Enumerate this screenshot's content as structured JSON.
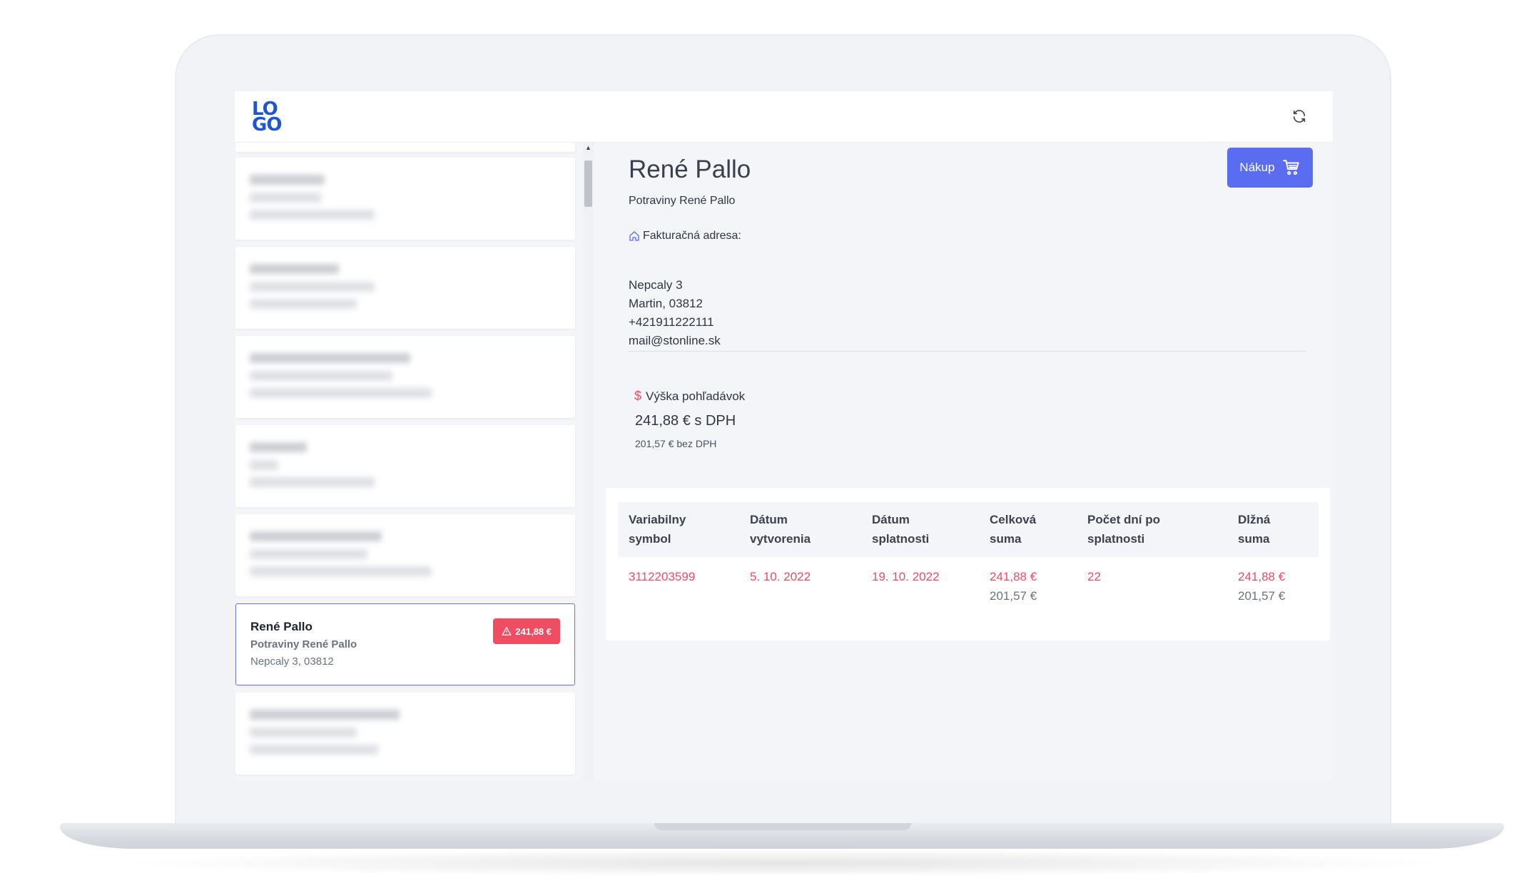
{
  "topbar": {
    "logo_top": "LO",
    "logo_bottom": "GO"
  },
  "customer_list": [
    {
      "blurred": true
    },
    {
      "blurred": true
    },
    {
      "blurred": true
    },
    {
      "blurred": true
    },
    {
      "blurred": true
    },
    {
      "blurred": false,
      "name": "René Pallo",
      "company": "Potraviny René Pallo",
      "address": "Nepcaly 3, 03812",
      "badge": "241,88 €"
    },
    {
      "blurred": true
    }
  ],
  "detail": {
    "name": "René Pallo",
    "company": "Potraviny René Pallo",
    "buy_button": "Nákup",
    "billing_label": "Fakturačná adresa:",
    "street": "Nepcaly 3",
    "city": "Martin, 03812",
    "phone": "+421911222111",
    "email": "mail@stonline.sk",
    "claims_label": "Výška pohľadávok",
    "claims_gross": "241,88 € s DPH",
    "claims_net": "201,57 € bez DPH"
  },
  "invoices": {
    "headers": {
      "variable_symbol": [
        "Variabilny",
        "symbol"
      ],
      "created": [
        "Dátum",
        "vytvorenia"
      ],
      "due": [
        "Dátum",
        "splatnosti"
      ],
      "total": [
        "Celková",
        "suma"
      ],
      "days_after_due": [
        "Počet dní po",
        "splatnosti"
      ],
      "owed": [
        "Dlžná",
        "suma"
      ]
    },
    "rows": [
      {
        "variable_symbol": "3112203599",
        "created": "5. 10. 2022",
        "due": "19. 10. 2022",
        "total_gross": "241,88 €",
        "total_net": "201,57 €",
        "days_after_due": "22",
        "owed_gross": "241,88 €",
        "owed_net": "201,57 €"
      }
    ]
  },
  "colors": {
    "accent": "#5a6cf0",
    "danger": "#f04c62",
    "logo": "#1b56d6"
  }
}
